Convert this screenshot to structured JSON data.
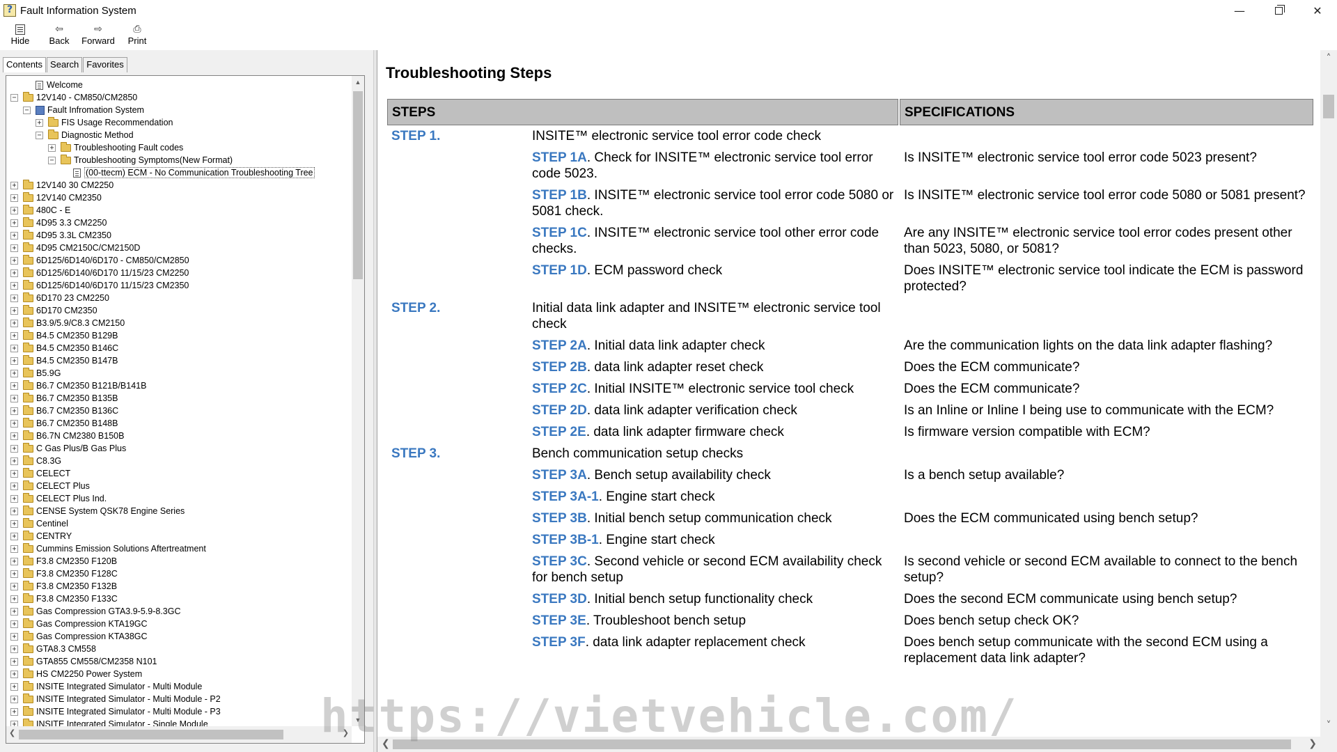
{
  "window": {
    "title": "Fault Information System",
    "minimize_glyph": "—",
    "close_glyph": "✕"
  },
  "toolbar": {
    "buttons": [
      {
        "label": "Hide",
        "icon": "hide-icon"
      },
      {
        "label": "Back",
        "icon": "back-arrow-icon",
        "glyph": "⇦"
      },
      {
        "label": "Forward",
        "icon": "forward-arrow-icon",
        "glyph": "⇨"
      },
      {
        "label": "Print",
        "icon": "printer-icon",
        "glyph": "⎙"
      }
    ]
  },
  "left_tabs": [
    "Contents",
    "Search",
    "Favorites"
  ],
  "tree": [
    {
      "level": 1,
      "exp": "",
      "icon": "doc",
      "label": "Welcome"
    },
    {
      "level": 0,
      "exp": "−",
      "icon": "folder",
      "label": "12V140 - CM850/CM2850"
    },
    {
      "level": 1,
      "exp": "−",
      "icon": "book",
      "label": "Fault Infromation System"
    },
    {
      "level": 2,
      "exp": "+",
      "icon": "folder",
      "label": "FIS Usage Recommendation"
    },
    {
      "level": 2,
      "exp": "−",
      "icon": "folder",
      "label": "Diagnostic Method"
    },
    {
      "level": 3,
      "exp": "+",
      "icon": "folder",
      "label": "Troubleshooting Fault codes"
    },
    {
      "level": 3,
      "exp": "−",
      "icon": "folder",
      "label": "Troubleshooting Symptoms(New Format)"
    },
    {
      "level": 4,
      "exp": "",
      "icon": "doc",
      "label": "(00-ttecm) ECM - No Communication Troubleshooting Tree",
      "selected": true
    },
    {
      "level": 0,
      "exp": "+",
      "icon": "folder",
      "label": "12V140 30 CM2250"
    },
    {
      "level": 0,
      "exp": "+",
      "icon": "folder",
      "label": "12V140 CM2350"
    },
    {
      "level": 0,
      "exp": "+",
      "icon": "folder",
      "label": "480C - E"
    },
    {
      "level": 0,
      "exp": "+",
      "icon": "folder",
      "label": "4D95 3.3 CM2250"
    },
    {
      "level": 0,
      "exp": "+",
      "icon": "folder",
      "label": "4D95 3.3L CM2350"
    },
    {
      "level": 0,
      "exp": "+",
      "icon": "folder",
      "label": "4D95 CM2150C/CM2150D"
    },
    {
      "level": 0,
      "exp": "+",
      "icon": "folder",
      "label": "6D125/6D140/6D170 - CM850/CM2850"
    },
    {
      "level": 0,
      "exp": "+",
      "icon": "folder",
      "label": "6D125/6D140/6D170 11/15/23 CM2250"
    },
    {
      "level": 0,
      "exp": "+",
      "icon": "folder",
      "label": "6D125/6D140/6D170 11/15/23 CM2350"
    },
    {
      "level": 0,
      "exp": "+",
      "icon": "folder",
      "label": "6D170 23 CM2250"
    },
    {
      "level": 0,
      "exp": "+",
      "icon": "folder",
      "label": "6D170 CM2350"
    },
    {
      "level": 0,
      "exp": "+",
      "icon": "folder",
      "label": "B3.9/5.9/C8.3 CM2150"
    },
    {
      "level": 0,
      "exp": "+",
      "icon": "folder",
      "label": "B4.5 CM2350 B129B"
    },
    {
      "level": 0,
      "exp": "+",
      "icon": "folder",
      "label": "B4.5 CM2350 B146C"
    },
    {
      "level": 0,
      "exp": "+",
      "icon": "folder",
      "label": "B4.5 CM2350 B147B"
    },
    {
      "level": 0,
      "exp": "+",
      "icon": "folder",
      "label": "B5.9G"
    },
    {
      "level": 0,
      "exp": "+",
      "icon": "folder",
      "label": "B6.7 CM2350 B121B/B141B"
    },
    {
      "level": 0,
      "exp": "+",
      "icon": "folder",
      "label": "B6.7 CM2350 B135B"
    },
    {
      "level": 0,
      "exp": "+",
      "icon": "folder",
      "label": "B6.7 CM2350 B136C"
    },
    {
      "level": 0,
      "exp": "+",
      "icon": "folder",
      "label": "B6.7 CM2350 B148B"
    },
    {
      "level": 0,
      "exp": "+",
      "icon": "folder",
      "label": "B6.7N CM2380 B150B"
    },
    {
      "level": 0,
      "exp": "+",
      "icon": "folder",
      "label": "C Gas Plus/B Gas Plus"
    },
    {
      "level": 0,
      "exp": "+",
      "icon": "folder",
      "label": "C8.3G"
    },
    {
      "level": 0,
      "exp": "+",
      "icon": "folder",
      "label": "CELECT"
    },
    {
      "level": 0,
      "exp": "+",
      "icon": "folder",
      "label": "CELECT Plus"
    },
    {
      "level": 0,
      "exp": "+",
      "icon": "folder",
      "label": "CELECT Plus Ind."
    },
    {
      "level": 0,
      "exp": "+",
      "icon": "folder",
      "label": "CENSE System QSK78 Engine Series"
    },
    {
      "level": 0,
      "exp": "+",
      "icon": "folder",
      "label": "Centinel"
    },
    {
      "level": 0,
      "exp": "+",
      "icon": "folder",
      "label": "CENTRY"
    },
    {
      "level": 0,
      "exp": "+",
      "icon": "folder",
      "label": "Cummins Emission Solutions Aftertreatment"
    },
    {
      "level": 0,
      "exp": "+",
      "icon": "folder",
      "label": "F3.8 CM2350 F120B"
    },
    {
      "level": 0,
      "exp": "+",
      "icon": "folder",
      "label": "F3.8 CM2350 F128C"
    },
    {
      "level": 0,
      "exp": "+",
      "icon": "folder",
      "label": "F3.8 CM2350 F132B"
    },
    {
      "level": 0,
      "exp": "+",
      "icon": "folder",
      "label": "F3.8 CM2350 F133C"
    },
    {
      "level": 0,
      "exp": "+",
      "icon": "folder",
      "label": "Gas Compression GTA3.9-5.9-8.3GC"
    },
    {
      "level": 0,
      "exp": "+",
      "icon": "folder",
      "label": "Gas Compression KTA19GC"
    },
    {
      "level": 0,
      "exp": "+",
      "icon": "folder",
      "label": "Gas Compression KTA38GC"
    },
    {
      "level": 0,
      "exp": "+",
      "icon": "folder",
      "label": "GTA8.3 CM558"
    },
    {
      "level": 0,
      "exp": "+",
      "icon": "folder",
      "label": "GTA855 CM558/CM2358 N101"
    },
    {
      "level": 0,
      "exp": "+",
      "icon": "folder",
      "label": "HS CM2250 Power System"
    },
    {
      "level": 0,
      "exp": "+",
      "icon": "folder",
      "label": "INSITE Integrated Simulator - Multi Module"
    },
    {
      "level": 0,
      "exp": "+",
      "icon": "folder",
      "label": "INSITE Integrated Simulator - Multi Module - P2"
    },
    {
      "level": 0,
      "exp": "+",
      "icon": "folder",
      "label": "INSITE Integrated Simulator - Multi Module - P3"
    },
    {
      "level": 0,
      "exp": "+",
      "icon": "folder",
      "label": "INSITE Integrated Simulator - Single Module"
    }
  ],
  "content": {
    "title": "Troubleshooting Steps",
    "headers": {
      "steps": "STEPS",
      "specs": "SPECIFICATIONS"
    },
    "rows": [
      {
        "step": "STEP 1.",
        "sub": "",
        "desc": "INSITE™ electronic service tool error code check",
        "spec": ""
      },
      {
        "step": "",
        "sub": "STEP 1A",
        "desc": ". Check for INSITE™ electronic service tool error code 5023.",
        "spec": "Is INSITE™ electronic service tool error code 5023 present?"
      },
      {
        "step": "",
        "sub": "STEP 1B",
        "desc": ". INSITE™ electronic service tool error code 5080 or 5081 check.",
        "spec": "Is INSITE™ electronic service tool error code 5080 or 5081 present?"
      },
      {
        "step": "",
        "sub": "STEP 1C",
        "desc": ". INSITE™ electronic service tool other error code checks.",
        "spec": "Are any INSITE™ electronic service tool error codes present other than 5023, 5080, or 5081?"
      },
      {
        "step": "",
        "sub": "STEP 1D",
        "desc": ". ECM password check",
        "spec": "Does INSITE™ electronic service tool indicate the ECM is password protected?"
      },
      {
        "step": "STEP 2.",
        "sub": "",
        "desc": "Initial data link adapter and INSITE™ electronic service tool check",
        "spec": ""
      },
      {
        "step": "",
        "sub": "STEP 2A",
        "desc": ". Initial data link adapter check",
        "spec": "Are the communication lights on the data link adapter flashing?"
      },
      {
        "step": "",
        "sub": "STEP 2B",
        "desc": ". data link adapter reset check",
        "spec": "Does the ECM communicate?"
      },
      {
        "step": "",
        "sub": "STEP 2C",
        "desc": ". Initial INSITE™ electronic service tool check",
        "spec": "Does the ECM communicate?"
      },
      {
        "step": "",
        "sub": "STEP 2D",
        "desc": ". data link adapter verification check",
        "spec": "Is an Inline or Inline I being use to communicate with the ECM?"
      },
      {
        "step": "",
        "sub": "STEP 2E",
        "desc": ". data link adapter firmware check",
        "spec": "Is firmware version compatible with ECM?"
      },
      {
        "step": "STEP 3.",
        "sub": "",
        "desc": "Bench communication setup checks",
        "spec": ""
      },
      {
        "step": "",
        "sub": "STEP 3A",
        "desc": ". Bench setup availability check",
        "spec": "Is a bench setup available?"
      },
      {
        "step": "",
        "sub": "STEP 3A-1",
        "desc": ". Engine start check",
        "spec": ""
      },
      {
        "step": "",
        "sub": "STEP 3B",
        "desc": ". Initial bench setup communication check",
        "spec": "Does the ECM communicated using bench setup?"
      },
      {
        "step": "",
        "sub": "STEP 3B-1",
        "desc": ". Engine start check",
        "spec": ""
      },
      {
        "step": "",
        "sub": "STEP 3C",
        "desc": ". Second vehicle or second ECM availability check for bench setup",
        "spec": "Is second vehicle or second ECM available to connect to the bench setup?"
      },
      {
        "step": "",
        "sub": "STEP 3D",
        "desc": ". Initial bench setup functionality check",
        "spec": "Does the second ECM communicate using bench setup?"
      },
      {
        "step": "",
        "sub": "STEP 3E",
        "desc": ". Troubleshoot bench setup",
        "spec": "Does bench setup check OK?"
      },
      {
        "step": "",
        "sub": "STEP 3F",
        "desc": ". data link adapter replacement check",
        "spec": "Does bench setup communicate with the second ECM using a replacement data link adapter?"
      }
    ]
  },
  "watermark": "https://vietvehicle.com/"
}
